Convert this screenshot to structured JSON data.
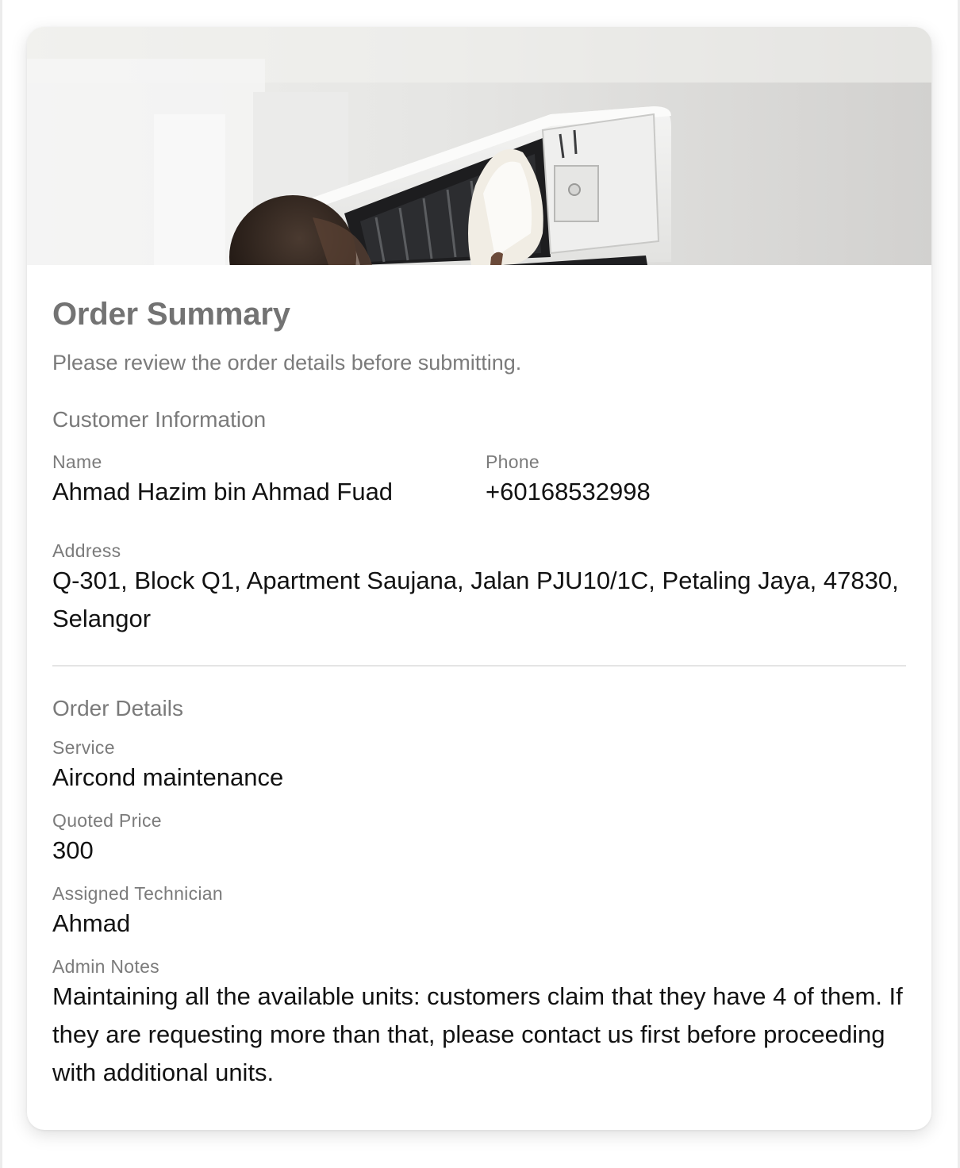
{
  "order_summary": {
    "title": "Order Summary",
    "subtitle": "Please review the order details before submitting."
  },
  "customer_information": {
    "heading": "Customer Information",
    "name_label": "Name",
    "name_value": "Ahmad Hazim bin Ahmad Fuad",
    "phone_label": "Phone",
    "phone_value": "+60168532998",
    "address_label": "Address",
    "address_value": "Q-301, Block Q1, Apartment Saujana, Jalan PJU10/1C, Petaling Jaya, 47830, Selangor"
  },
  "order_details": {
    "heading": "Order Details",
    "service_label": "Service",
    "service_value": "Aircond maintenance",
    "price_label": "Quoted Price",
    "price_value": "300",
    "technician_label": "Assigned Technician",
    "technician_value": "Ahmad",
    "notes_label": "Admin Notes",
    "notes_value": "Maintaining all the available units: customers claim that they have 4 of them. If they are requesting more than that, please contact us first before proceeding with additional units."
  },
  "hero_image": {
    "icon": "aircond-technician-photo"
  }
}
